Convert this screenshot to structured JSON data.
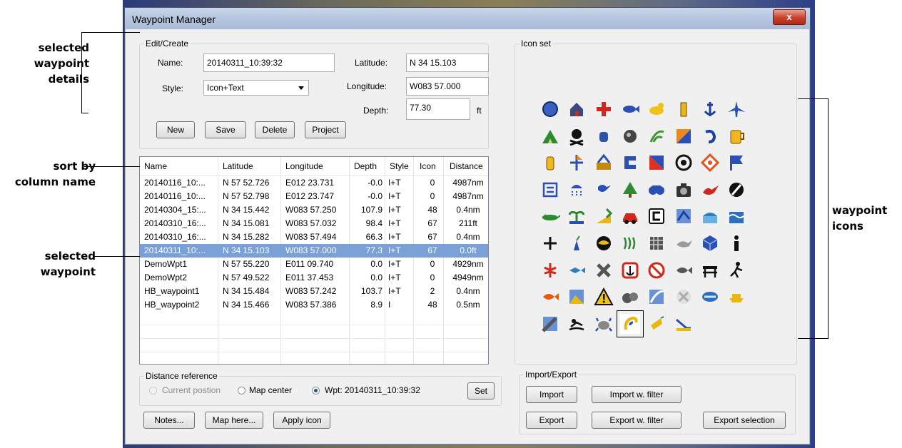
{
  "window": {
    "title": "Waypoint Manager",
    "close_glyph": "x"
  },
  "edit": {
    "group_label": "Edit/Create",
    "name_label": "Name:",
    "name_value": "20140311_10:39:32",
    "style_label": "Style:",
    "style_value": "Icon+Text",
    "latitude_label": "Latitude:",
    "latitude_value": "N 34 15.103",
    "longitude_label": "Longitude:",
    "longitude_value": "W083 57.000",
    "depth_label": "Depth:",
    "depth_value": "77.30",
    "depth_unit": "ft",
    "buttons": {
      "new": "New",
      "save": "Save",
      "delete": "Delete",
      "project": "Project"
    }
  },
  "table": {
    "headers": [
      "Name",
      "Latitude",
      "Longitude",
      "Depth",
      "Style",
      "Icon",
      "Distance"
    ],
    "rows": [
      [
        "20140116_10:...",
        "N 57 52.726",
        "E012 23.731",
        "-0.0",
        "I+T",
        "0",
        "4987nm"
      ],
      [
        "20140116_10:...",
        "N 57 52.798",
        "E012 23.747",
        "-0.0",
        "I+T",
        "0",
        "4987nm"
      ],
      [
        "20140304_15:...",
        "N 34 15.442",
        "W083 57.250",
        "107.9",
        "I+T",
        "48",
        "0.4nm"
      ],
      [
        "20140310_16:...",
        "N 34 15.081",
        "W083 57.032",
        "98.4",
        "I+T",
        "67",
        "211ft"
      ],
      [
        "20140310_16:...",
        "N 34 15.282",
        "W083 57.494",
        "66.3",
        "I+T",
        "67",
        "0.4nm"
      ],
      [
        "20140311_10:...",
        "N 34 15.103",
        "W083 57.000",
        "77.3",
        "I+T",
        "67",
        "0.0ft"
      ],
      [
        "DemoWpt1",
        "N 57 55.220",
        "E011 09.740",
        "0.0",
        "I+T",
        "0",
        "4929nm"
      ],
      [
        "DemoWpt2",
        "N 57 49.522",
        "E011 37.453",
        "0.0",
        "I+T",
        "0",
        "4949nm"
      ],
      [
        "HB_waypoint1",
        "N 34 15.484",
        "W083 57.242",
        "103.7",
        "I+T",
        "2",
        "0.4nm"
      ],
      [
        "HB_waypoint2",
        "N 34 15.466",
        "W083 57.386",
        "8.9",
        "I",
        "48",
        "0.5nm"
      ]
    ],
    "selected_row": 5
  },
  "distance": {
    "group_label": "Distance reference",
    "current_position": "Current postion",
    "map_center": "Map center",
    "wpt": "Wpt: 20140311_10:39:32",
    "set_button": "Set"
  },
  "bottom_buttons": {
    "notes": "Notes...",
    "map_here": "Map here...",
    "apply_icon": "Apply icon"
  },
  "icon_set": {
    "group_label": "Icon set",
    "icons": [
      "circle-icon",
      "house-icon",
      "red-cross-icon",
      "fish-icon",
      "duck-icon",
      "lighthouse-icon",
      "anchor-icon",
      "airplane-icon",
      "campsite-icon",
      "skull-crossbones-icon",
      "mailbox-icon",
      "rock-icon",
      "weed-icon",
      "flag-diagonal-icon",
      "hook-icon",
      "beer-mug-icon",
      "bottle-icon",
      "buoy-icon",
      "dock-icon",
      "marker-c-icon",
      "diagonal-marker-icon",
      "target-icon",
      "diamond-icon",
      "flag-icon",
      "list-icon",
      "rain-icon",
      "bird-icon",
      "tree-icon",
      "binoculars-icon",
      "camera-icon",
      "diver-icon",
      "no-entry-icon",
      "gator-icon",
      "palm-icon",
      "ramp-icon",
      "car-icon",
      "c-sign-icon",
      "map-icon",
      "bridge-icon",
      "water-icon",
      "cross-hair-icon",
      "stump-icon",
      "eye-icon",
      "reeds-icon",
      "gravel-icon",
      "duck-gray-icon",
      "cube-icon",
      "info-icon",
      "lobster-icon",
      "small-fish-icon",
      "x-marker-icon",
      "no-anchor-icon",
      "no-fishing-icon",
      "fish-gray-icon",
      "table-icon",
      "hiker-icon",
      "red-fish-icon",
      "swamp-icon",
      "warning-icon",
      "boulders-icon",
      "dolphin-icon",
      "shellfish-icon",
      "reef-icon",
      "boat-icon",
      "gun-icon",
      "swimmer-icon",
      "crab-icon",
      "rope-hook-icon",
      "shrimp-icon",
      "slope-icon"
    ],
    "selected_index": 67
  },
  "import_export": {
    "group_label": "Import/Export",
    "import": "Import",
    "import_filter": "Import w. filter",
    "export": "Export",
    "export_filter": "Export w. filter",
    "export_selection": "Export selection"
  },
  "annotations": {
    "selected_details": [
      "selected",
      "waypoint",
      "details"
    ],
    "sort_by": [
      "sort by",
      "column name"
    ],
    "selected_waypoint": [
      "selected",
      "waypoint"
    ],
    "waypoint_icons": [
      "waypoint",
      "icons"
    ]
  },
  "colors": {
    "selection": "#7aa0d6",
    "title_bar": "#b5c5df",
    "close_button": "#c8402c"
  }
}
